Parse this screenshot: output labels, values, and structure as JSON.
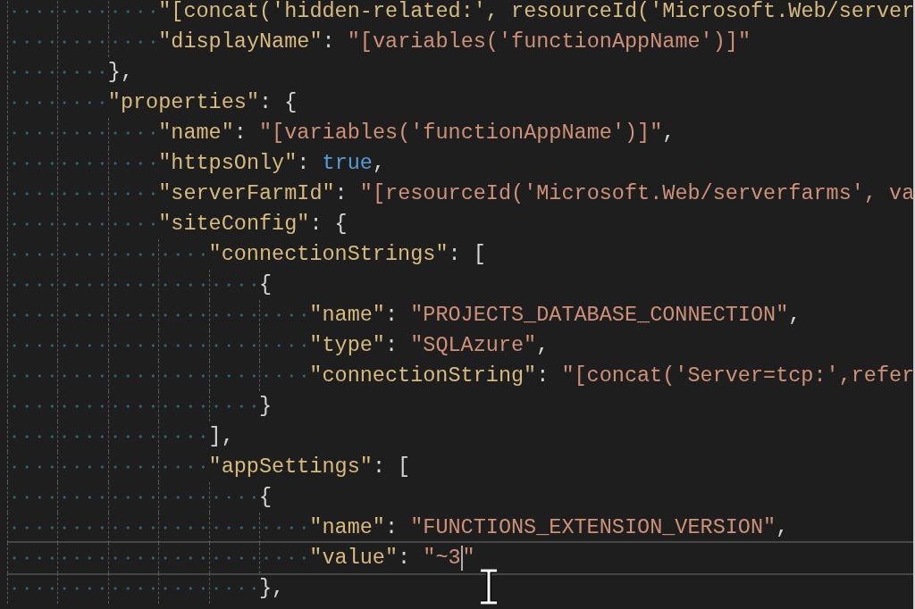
{
  "lines": [
    {
      "children": [
        {
          "current": false,
          "tokens": [
            {
              "kind": "key",
              "text": "\"[concat('hidden-related:', resourceId('Microsoft.Web/server"
            }
          ]
        },
        {
          "current": false,
          "tokens": [
            {
              "kind": "key",
              "text": "\"displayName\""
            },
            {
              "kind": "punct",
              "text": ": "
            },
            {
              "kind": "string",
              "text": "\"[variables('functionAppName')]\""
            }
          ]
        }
      ]
    },
    {
      "current": false,
      "tokens": [
        {
          "kind": "punct",
          "text": "},"
        }
      ]
    },
    {
      "current": false,
      "tokens": [
        {
          "kind": "key",
          "text": "\"properties\""
        },
        {
          "kind": "punct",
          "text": ": {"
        }
      ],
      "children": [
        {
          "current": false,
          "tokens": [
            {
              "kind": "key",
              "text": "\"name\""
            },
            {
              "kind": "punct",
              "text": ": "
            },
            {
              "kind": "string",
              "text": "\"[variables('functionAppName')]\""
            },
            {
              "kind": "punct",
              "text": ","
            }
          ]
        },
        {
          "current": false,
          "tokens": [
            {
              "kind": "key",
              "text": "\"httpsOnly\""
            },
            {
              "kind": "punct",
              "text": ": "
            },
            {
              "kind": "bool",
              "text": "true"
            },
            {
              "kind": "punct",
              "text": ","
            }
          ]
        },
        {
          "current": false,
          "tokens": [
            {
              "kind": "key",
              "text": "\"serverFarmId\""
            },
            {
              "kind": "punct",
              "text": ": "
            },
            {
              "kind": "string",
              "text": "\"[resourceId('Microsoft.Web/serverfarms', va"
            }
          ]
        },
        {
          "current": false,
          "tokens": [
            {
              "kind": "key",
              "text": "\"siteConfig\""
            },
            {
              "kind": "punct",
              "text": ": {"
            }
          ],
          "children": [
            {
              "current": false,
              "tokens": [
                {
                  "kind": "key",
                  "text": "\"connectionStrings\""
                },
                {
                  "kind": "punct",
                  "text": ": ["
                }
              ],
              "children": [
                {
                  "current": false,
                  "tokens": [
                    {
                      "kind": "punct",
                      "text": "{"
                    }
                  ],
                  "children": [
                    {
                      "current": false,
                      "tokens": [
                        {
                          "kind": "key",
                          "text": "\"name\""
                        },
                        {
                          "kind": "punct",
                          "text": ": "
                        },
                        {
                          "kind": "string",
                          "text": "\"PROJECTS_DATABASE_CONNECTION\""
                        },
                        {
                          "kind": "punct",
                          "text": ","
                        }
                      ]
                    },
                    {
                      "current": false,
                      "tokens": [
                        {
                          "kind": "key",
                          "text": "\"type\""
                        },
                        {
                          "kind": "punct",
                          "text": ": "
                        },
                        {
                          "kind": "string",
                          "text": "\"SQLAzure\""
                        },
                        {
                          "kind": "punct",
                          "text": ","
                        }
                      ]
                    },
                    {
                      "current": false,
                      "tokens": [
                        {
                          "kind": "key",
                          "text": "\"connectionString\""
                        },
                        {
                          "kind": "punct",
                          "text": ": "
                        },
                        {
                          "kind": "string",
                          "text": "\"[concat('Server=tcp:',refer"
                        }
                      ]
                    }
                  ]
                },
                {
                  "current": false,
                  "tokens": [
                    {
                      "kind": "punct",
                      "text": "}"
                    }
                  ]
                }
              ]
            },
            {
              "current": false,
              "tokens": [
                {
                  "kind": "punct",
                  "text": "],"
                }
              ]
            },
            {
              "current": false,
              "tokens": [
                {
                  "kind": "key",
                  "text": "\"appSettings\""
                },
                {
                  "kind": "punct",
                  "text": ": ["
                }
              ],
              "children": [
                {
                  "current": false,
                  "tokens": [
                    {
                      "kind": "punct",
                      "text": "{"
                    }
                  ],
                  "children": [
                    {
                      "current": false,
                      "tokens": [
                        {
                          "kind": "key",
                          "text": "\"name\""
                        },
                        {
                          "kind": "punct",
                          "text": ": "
                        },
                        {
                          "kind": "string",
                          "text": "\"FUNCTIONS_EXTENSION_VERSION\""
                        },
                        {
                          "kind": "punct",
                          "text": ","
                        }
                      ]
                    },
                    {
                      "current": true,
                      "tokens": [
                        {
                          "kind": "key",
                          "text": "\"value\""
                        },
                        {
                          "kind": "punct",
                          "text": ": "
                        },
                        {
                          "kind": "string",
                          "text": "\"~3",
                          "caret": true
                        },
                        {
                          "kind": "string",
                          "text": "\""
                        }
                      ]
                    }
                  ]
                },
                {
                  "current": false,
                  "tokens": [
                    {
                      "kind": "punct",
                      "text": "},"
                    }
                  ]
                }
              ]
            }
          ]
        }
      ]
    }
  ]
}
